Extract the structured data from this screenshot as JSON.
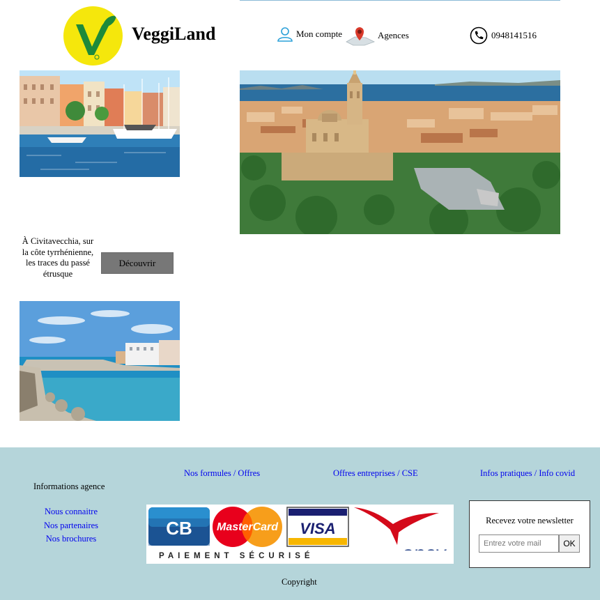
{
  "brand": {
    "name": "VeggiLand"
  },
  "header": {
    "account_label": "Mon compte",
    "agencies_label": "Agences",
    "phone": "0948141516"
  },
  "icons": {
    "logo": "vegan-v-leaf-icon",
    "account": "user-icon",
    "agencies": "map-pin-icon",
    "phone": "phone-icon"
  },
  "images": {
    "harbor": "harbor-photo",
    "hero": "city-aerial-photo",
    "coast": "seaside-photo"
  },
  "promo": {
    "caption": "À Civitavecchia, sur la côte tyrrhénienne, les traces du passé étrusque",
    "button_label": "Découvrir"
  },
  "footer": {
    "info_title": "Informations agence",
    "about_links": [
      "Nous connaitre",
      "Nos partenaires",
      "Nos brochures"
    ],
    "formules_link": "Nos formules / Offres",
    "entreprises_link": "Offres entreprises / CSE",
    "infos_link": "Infos pratiques / Info covid",
    "payment": {
      "cb": "CB",
      "mastercard": "MasterCard",
      "visa": "VISA",
      "ancv": "ancv",
      "secure_label": "PAIEMENT SÉCURISÉ"
    },
    "copyright": "Copyright"
  },
  "newsletter": {
    "title": "Recevez votre newsletter",
    "placeholder": "Entrez votre mail",
    "button_label": "OK"
  },
  "colors": {
    "footer_bg": "#b5d5da",
    "logo_yellow": "#f5e70c",
    "logo_green": "#1e8a3a",
    "link": "#0000ee",
    "button_gray": "#777777"
  }
}
